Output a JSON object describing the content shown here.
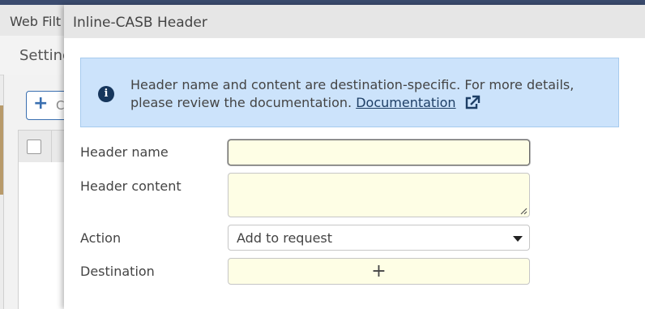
{
  "background": {
    "tab_title": "Web Filt",
    "section_title": "Setting",
    "add_button_plus": "+",
    "add_button_fragment": "C"
  },
  "dialog": {
    "title": "Inline-CASB Header",
    "info": {
      "icon": "info-icon",
      "text": "Header name and content are destination-specific. For more details, please review the documentation.",
      "link_label": "Documentation",
      "link_icon": "external-link-icon"
    },
    "fields": {
      "header_name": {
        "label": "Header name",
        "value": "",
        "placeholder": ""
      },
      "header_content": {
        "label": "Header content",
        "value": "",
        "placeholder": ""
      },
      "action": {
        "label": "Action",
        "selected": "Add to request"
      },
      "destination": {
        "label": "Destination",
        "add_symbol": "+"
      }
    }
  },
  "colors": {
    "info_background": "#cce3fb",
    "field_background": "#fefee5",
    "link": "#1e3f66"
  }
}
